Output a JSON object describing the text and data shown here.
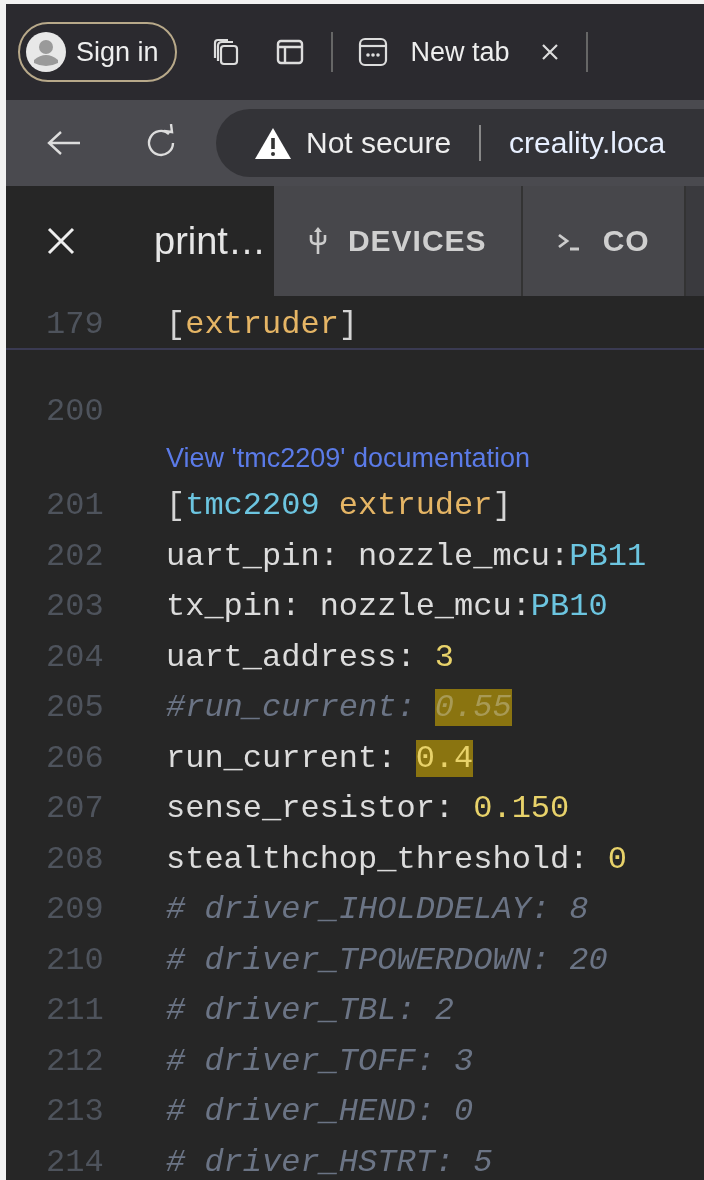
{
  "browser": {
    "sign_in": "Sign in",
    "tabs": [
      {
        "label": "New tab"
      }
    ],
    "address": {
      "security": "Not secure",
      "url": "creality.loca"
    }
  },
  "app_tabs": [
    {
      "label": "print…",
      "kind": "file",
      "selected": true
    },
    {
      "label": "DEVICES",
      "kind": "devices",
      "selected": false
    },
    {
      "label": "CO",
      "kind": "console",
      "selected": false
    }
  ],
  "editor": {
    "sticky": {
      "number": "179",
      "tokens": [
        {
          "text": "[",
          "kind": "bracket",
          "highlighted": false
        },
        {
          "text": "extruder",
          "kind": "name",
          "highlighted": false
        },
        {
          "text": "]",
          "kind": "bracket",
          "highlighted": false
        }
      ]
    },
    "lines": [
      {
        "number": "200"
      },
      {
        "codelens": "View 'tmc2209' documentation"
      },
      {
        "number": "201",
        "tokens": [
          {
            "text": "[",
            "kind": "bracket",
            "highlighted": false
          },
          {
            "text": "tmc2209",
            "kind": "type",
            "highlighted": false
          },
          {
            "text": " extruder",
            "kind": "name",
            "highlighted": false
          },
          {
            "text": "]",
            "kind": "bracket",
            "highlighted": false
          }
        ]
      },
      {
        "number": "202",
        "tokens": [
          {
            "text": "uart_pin: nozzle_mcu:",
            "kind": "plain",
            "highlighted": false
          },
          {
            "text": "PB11",
            "kind": "pin",
            "highlighted": false
          }
        ]
      },
      {
        "number": "203",
        "tokens": [
          {
            "text": "tx_pin: nozzle_mcu:",
            "kind": "plain",
            "highlighted": false
          },
          {
            "text": "PB10",
            "kind": "pin",
            "highlighted": false
          }
        ]
      },
      {
        "number": "204",
        "tokens": [
          {
            "text": "uart_address: ",
            "kind": "plain",
            "highlighted": false
          },
          {
            "text": "3",
            "kind": "number",
            "highlighted": false
          }
        ]
      },
      {
        "number": "205",
        "tokens": [
          {
            "text": "#run_current: ",
            "kind": "comment",
            "highlighted": false
          },
          {
            "text": "0.55",
            "kind": "comment",
            "highlighted": true
          }
        ]
      },
      {
        "number": "206",
        "tokens": [
          {
            "text": "run_current: ",
            "kind": "plain",
            "highlighted": false
          },
          {
            "text": "0.4",
            "kind": "number",
            "highlighted": true
          }
        ]
      },
      {
        "number": "207",
        "tokens": [
          {
            "text": "sense_resistor: ",
            "kind": "plain",
            "highlighted": false
          },
          {
            "text": "0.150",
            "kind": "number",
            "highlighted": false
          }
        ]
      },
      {
        "number": "208",
        "tokens": [
          {
            "text": "stealthchop_threshold: ",
            "kind": "plain",
            "highlighted": false
          },
          {
            "text": "0",
            "kind": "number",
            "highlighted": false
          }
        ]
      },
      {
        "number": "209",
        "tokens": [
          {
            "text": "# driver_IHOLDDELAY: 8",
            "kind": "comment",
            "highlighted": false
          }
        ]
      },
      {
        "number": "210",
        "tokens": [
          {
            "text": "# driver_TPOWERDOWN: 20",
            "kind": "comment",
            "highlighted": false
          }
        ]
      },
      {
        "number": "211",
        "tokens": [
          {
            "text": "# driver_TBL: 2",
            "kind": "comment",
            "highlighted": false
          }
        ]
      },
      {
        "number": "212",
        "tokens": [
          {
            "text": "# driver_TOFF: 3",
            "kind": "comment",
            "highlighted": false
          }
        ]
      },
      {
        "number": "213",
        "tokens": [
          {
            "text": "# driver_HEND: 0",
            "kind": "comment",
            "highlighted": false
          }
        ]
      },
      {
        "number": "214",
        "tokens": [
          {
            "text": "# driver_HSTRT: 5",
            "kind": "comment",
            "highlighted": false
          }
        ]
      }
    ]
  }
}
